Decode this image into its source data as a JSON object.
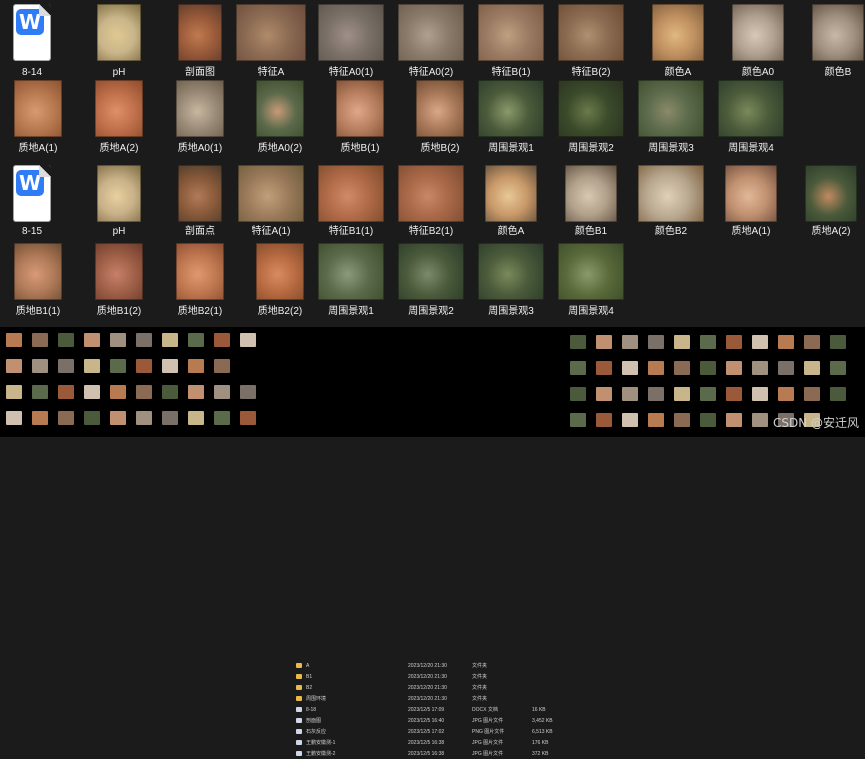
{
  "rows": [
    {
      "items": [
        {
          "label": "8-14",
          "kind": "wps"
        },
        {
          "label": "pH",
          "kind": "photo",
          "colors": [
            "#c8b58a",
            "#e0c890",
            "#7a6a3c"
          ]
        },
        {
          "label": "剖面图",
          "kind": "photo",
          "colors": [
            "#9a5a3a",
            "#c07a50",
            "#5a3a2a"
          ]
        },
        {
          "label": "特征A",
          "kind": "photo",
          "colors": [
            "#8a6a52",
            "#b08a6a",
            "#6a4a3a"
          ]
        },
        {
          "label": "特征A0(1)",
          "kind": "photo",
          "colors": [
            "#7a7068",
            "#a09088",
            "#5a524a"
          ]
        },
        {
          "label": "特征A0(2)",
          "kind": "photo",
          "colors": [
            "#8a7a6a",
            "#b0a090",
            "#6a5a4a"
          ]
        },
        {
          "label": "特征B(1)",
          "kind": "photo",
          "colors": [
            "#9a7a62",
            "#c0a080",
            "#7a5a42"
          ]
        },
        {
          "label": "特征B(2)",
          "kind": "photo",
          "colors": [
            "#8a6a50",
            "#b09070",
            "#6a4a30"
          ]
        },
        {
          "label": "颜色A",
          "kind": "photo",
          "colors": [
            "#c09060",
            "#e0b880",
            "#7a5a3a"
          ]
        },
        {
          "label": "颜色A0",
          "kind": "photo",
          "colors": [
            "#b0a090",
            "#d8c8b8",
            "#6a5a4a"
          ]
        },
        {
          "label": "颜色B",
          "kind": "photo",
          "colors": [
            "#a09080",
            "#c8b8a8",
            "#5a4a3a"
          ]
        }
      ]
    },
    {
      "items": [
        {
          "label": "质地A(1)",
          "kind": "photo",
          "colors": [
            "#b87a50",
            "#d89a70",
            "#8a5030"
          ]
        },
        {
          "label": "质地A(2)",
          "kind": "photo",
          "colors": [
            "#c0704a",
            "#e09068",
            "#8a4a2a"
          ]
        },
        {
          "label": "质地A0(1)",
          "kind": "photo",
          "colors": [
            "#9a8a78",
            "#c8b8a0",
            "#6a5a48"
          ]
        },
        {
          "label": "质地A0(2)",
          "kind": "photo",
          "colors": [
            "#5a6a4a",
            "#c89a78",
            "#3a4a2a"
          ]
        },
        {
          "label": "质地B(1)",
          "kind": "photo",
          "colors": [
            "#b88060",
            "#e0a888",
            "#7a4a30"
          ]
        },
        {
          "label": "质地B(2)",
          "kind": "photo",
          "colors": [
            "#a87858",
            "#d8a888",
            "#6a4830"
          ]
        },
        {
          "label": "周围景观1",
          "kind": "photo",
          "colors": [
            "#4a5a3a",
            "#8a9a6a",
            "#2a3a2a"
          ]
        },
        {
          "label": "周围景观2",
          "kind": "photo",
          "colors": [
            "#3a4a2a",
            "#6a7a4a",
            "#2a3020"
          ]
        },
        {
          "label": "周围景观3",
          "kind": "photo",
          "colors": [
            "#5a6a4a",
            "#8a8a6a",
            "#3a4a2a"
          ]
        },
        {
          "label": "周围景观4",
          "kind": "photo",
          "colors": [
            "#4a5a3a",
            "#7a8a5a",
            "#2a3a2a"
          ]
        }
      ]
    },
    {
      "items": [
        {
          "label": "8-15",
          "kind": "wps"
        },
        {
          "label": "pH",
          "kind": "photo",
          "colors": [
            "#c8b088",
            "#e8d0a0",
            "#7a6a40"
          ]
        },
        {
          "label": "剖面点",
          "kind": "photo",
          "colors": [
            "#8a5a3a",
            "#b07a5a",
            "#4a3a2a"
          ]
        },
        {
          "label": "特征A(1)",
          "kind": "photo",
          "colors": [
            "#9a7a5a",
            "#c0a07a",
            "#6a5a3a"
          ]
        },
        {
          "label": "特征B1(1)",
          "kind": "photo",
          "colors": [
            "#b06a48",
            "#d08a68",
            "#7a4a2a"
          ]
        },
        {
          "label": "特征B2(1)",
          "kind": "photo",
          "colors": [
            "#a86848",
            "#c88868",
            "#7a4a30"
          ]
        },
        {
          "label": "颜色A",
          "kind": "photo",
          "colors": [
            "#c89868",
            "#e8c898",
            "#5a4a3a"
          ]
        },
        {
          "label": "颜色B1",
          "kind": "photo",
          "colors": [
            "#b0a08a",
            "#d8c8b0",
            "#5a4a3a"
          ]
        },
        {
          "label": "颜色B2",
          "kind": "photo",
          "colors": [
            "#b8a890",
            "#e0d0b8",
            "#7a5a3a"
          ]
        },
        {
          "label": "质地A(1)",
          "kind": "photo",
          "colors": [
            "#c09070",
            "#e0b898",
            "#6a4a3a"
          ]
        },
        {
          "label": "质地A(2)",
          "kind": "photo",
          "colors": [
            "#4a5a3a",
            "#c08a60",
            "#2a3a2a"
          ]
        }
      ]
    },
    {
      "items": [
        {
          "label": "质地B1(1)",
          "kind": "photo",
          "colors": [
            "#b07a58",
            "#d89a78",
            "#6a4a30"
          ]
        },
        {
          "label": "质地B1(2)",
          "kind": "photo",
          "colors": [
            "#a06048",
            "#c88068",
            "#6a3a2a"
          ]
        },
        {
          "label": "质地B2(1)",
          "kind": "photo",
          "colors": [
            "#c07850",
            "#e09870",
            "#8a4a30"
          ]
        },
        {
          "label": "质地B2(2)",
          "kind": "photo",
          "colors": [
            "#b86a40",
            "#d88a60",
            "#7a4a2a"
          ]
        },
        {
          "label": "周围景观1",
          "kind": "photo",
          "colors": [
            "#5a6a4a",
            "#8a9a7a",
            "#3a4a2a"
          ]
        },
        {
          "label": "周围景观2",
          "kind": "photo",
          "colors": [
            "#4a5a3a",
            "#7a8a6a",
            "#2a3a2a"
          ]
        },
        {
          "label": "周围景观3",
          "kind": "photo",
          "colors": [
            "#4a5a3a",
            "#7a8a5a",
            "#2a3a2a"
          ]
        },
        {
          "label": "周围景观4",
          "kind": "photo",
          "colors": [
            "#5a6a3a",
            "#8a9a6a",
            "#3a4a2a"
          ]
        }
      ]
    }
  ],
  "file_list": [
    {
      "name": "A",
      "date": "2023/12/20 21:30",
      "type": "文件夹",
      "size": ""
    },
    {
      "name": "B1",
      "date": "2023/12/20 21:30",
      "type": "文件夹",
      "size": ""
    },
    {
      "name": "B2",
      "date": "2023/12/20 21:30",
      "type": "文件夹",
      "size": ""
    },
    {
      "name": "周围环境",
      "date": "2023/12/20 21:30",
      "type": "文件夹",
      "size": ""
    },
    {
      "name": "8-18",
      "date": "2023/12/5 17:09",
      "type": "DOCX 文档",
      "size": "16 KB"
    },
    {
      "name": "剖面图",
      "date": "2023/12/5 16:40",
      "type": "JPG 图片文件",
      "size": "3,452 KB"
    },
    {
      "name": "石灰反应",
      "date": "2023/12/5 17:02",
      "type": "PNG 图片文件",
      "size": "6,513 KB"
    },
    {
      "name": "王鹏安徽测-1",
      "date": "2023/12/5 16:38",
      "type": "JPG 图片文件",
      "size": "176 KB"
    },
    {
      "name": "王鹏安徽测-2",
      "date": "2023/12/5 16:38",
      "type": "JPG 图片文件",
      "size": "372 KB"
    }
  ],
  "watermark": "CSDN @安迁风"
}
